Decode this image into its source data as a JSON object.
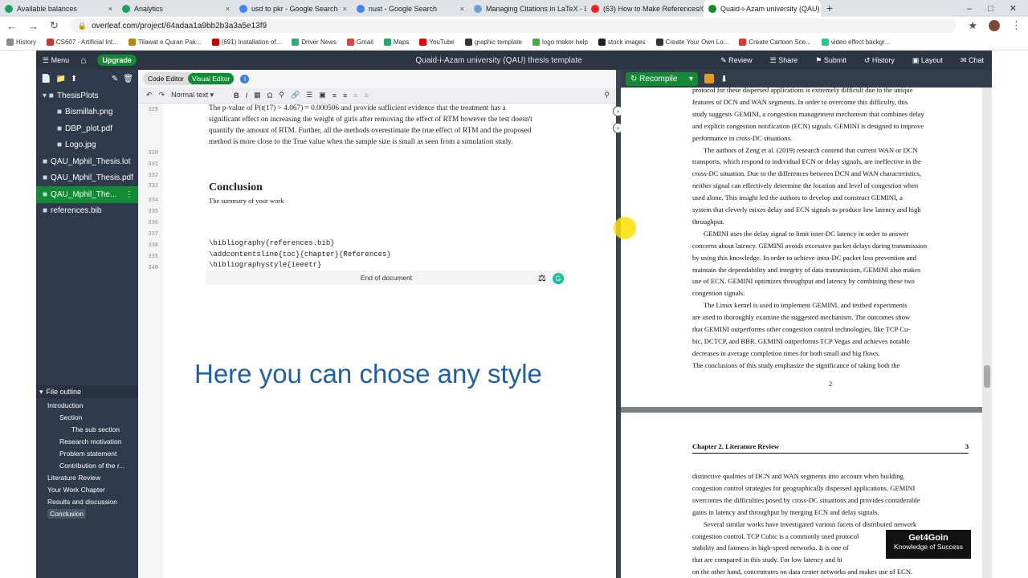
{
  "browser": {
    "tabs": [
      {
        "label": "Available balances",
        "color": "#1aa260"
      },
      {
        "label": "Analytics",
        "color": "#1aa260"
      },
      {
        "label": "usd to pkr - Google Search",
        "color": "#4285f4"
      },
      {
        "label": "nust - Google Search",
        "color": "#4285f4"
      },
      {
        "label": "Managing Citations in LaTeX - L",
        "color": "#6ca0d6"
      },
      {
        "label": "(63) How to Make References/C",
        "color": "#e22"
      },
      {
        "label": "Quaid-i-Azam university (QAU)",
        "color": "#138a36"
      }
    ],
    "url": "overleaf.com/project/64adaa1a9bb2b3a3a5e13f9",
    "bookmarks": [
      "History",
      "CS607 - Artificial Int...",
      "Tilawat e Quran Pak...",
      "(691) Installation of...",
      "Driver News",
      "Gmail",
      "Maps",
      "YouTube",
      "graphic template",
      "logo maker help",
      "stock images",
      "Create Your Own Lo...",
      "Create Cartoon Sce...",
      "video effect backgr..."
    ]
  },
  "topbar": {
    "menu": "Menu",
    "upgrade": "Upgrade",
    "title": "Quaid-i-Azam university (QAU) thesis template",
    "actions": [
      "Review",
      "Share",
      "Submit",
      "History",
      "Layout",
      "Chat"
    ]
  },
  "files": [
    {
      "name": "ThesisPlots",
      "indent": 0,
      "folder": true
    },
    {
      "name": "Bismillah.png",
      "indent": 1
    },
    {
      "name": "DBP_plot.pdf",
      "indent": 1
    },
    {
      "name": "Logo.jpg",
      "indent": 1
    },
    {
      "name": "QAU_Mphil_Thesis.lot",
      "indent": 0
    },
    {
      "name": "QAU_Mphil_Thesis.pdf",
      "indent": 0
    },
    {
      "name": "QAU_Mphil_The...",
      "indent": 0,
      "selected": true
    },
    {
      "name": "references.bib",
      "indent": 0
    }
  ],
  "outline": {
    "header": "File outline",
    "items": [
      {
        "label": "Introduction",
        "level": 0
      },
      {
        "label": "Section",
        "level": 1
      },
      {
        "label": "The sub section",
        "level": 2
      },
      {
        "label": "Research motivation",
        "level": 1
      },
      {
        "label": "Problem statement",
        "level": 1
      },
      {
        "label": "Contribution of the r...",
        "level": 1
      },
      {
        "label": "Literature Review",
        "level": 0
      },
      {
        "label": "Your Work Chapter",
        "level": 0
      },
      {
        "label": "Results and discussion",
        "level": 0
      },
      {
        "label": "Conclusion",
        "level": 0,
        "selected": true
      }
    ]
  },
  "editor": {
    "code_editor": "Code Editor",
    "visual_editor": "Visual Editor",
    "style": "Normal text",
    "line_numbers": [
      "329",
      "330",
      "331",
      "332",
      "333",
      "334",
      "335",
      "336",
      "337",
      "338",
      "339",
      "340"
    ],
    "para1": [
      "The p-value of P(t(17) > 4.067) = 0.000506 and provide sufficient evidence that the treatment has a",
      "significant effect on increasing the weight of girls after removing the effect of RTM however the test doesn't",
      "quantify the amount of RTM. Further, all the methods overestimate the true effect of RTM and the proposed",
      "method is more close to the True value when the sample size is small as seen from a simulation study."
    ],
    "heading": "Conclusion",
    "summary": "The summary of your work",
    "code_lines": [
      "\\bibliography{references.bib}",
      "\\addcontentsline{toc}{chapter}{References}",
      "\\bibliographystyle{ieeetr}"
    ],
    "end_of_document": "End of document",
    "overlay_caption": "Here you can chose any style"
  },
  "pdf": {
    "recompile": "Recompile",
    "page1_lines": [
      "protocol for these dispersed applications is extremely difficult due to the unique",
      "features of DCN and WAN segments. In order to overcome this difficulty, this",
      "study suggests GEMINI, a congestion management mechanism that combines delay",
      "and explicit congestion notification (ECN) signals. GEMINI is designed to improve",
      "performance in cross-DC situations.",
      "The authors of Zeng et al. (2019) research contend that current WAN or DCN",
      "transports, which respond to individual ECN or delay signals, are ineffective in the",
      "cross-DC situation. Due to the differences between DCN and WAN characteristics,",
      "neither signal can effectively determine the location and level of congestion when",
      "used alone. This insight led the authors to develop and construct GEMINI, a",
      "system that cleverly mixes delay and ECN signals to produce low latency and high",
      "throughput.",
      "GEMINI uses the delay signal to limit inter-DC latency in order to answer",
      "concerns about latency. GEMINI avoids excessive packet delays during transmission",
      "by using this knowledge. In order to achieve intra-DC packet loss prevention and",
      "maintain the dependability and integrity of data transmission, GEMINI also makes",
      "use of ECN. GEMINI optimizes throughput and latency by combining these two",
      "congestion signals.",
      "The Linux kernel is used to implement GEMINI, and testbed experiments",
      "are used to thoroughly examine the suggested mechanism. The outcomes show",
      "that GEMINI outperforms other congestion control technologies, like TCP Cu-",
      "bic, DCTCP, and BBR. GEMINI outperforms TCP Vegas and achieves notable",
      "decreases in average completion times for both small and big flows.",
      "The conclusions of this study emphasize the significance of taking both the"
    ],
    "page1_number": "2",
    "page2_header": "Chapter 2.   Literature Review",
    "page2_number": "3",
    "page2_lines": [
      "distinctive qualities of DCN and WAN segments into account when building",
      "congestion control strategies for geographically dispersed applications. GEMINI",
      "overcomes the difficulties posed by cross-DC situations and provides considerable",
      "gains in latency and throughput by merging ECN and delay signals.",
      "Several similar works have investigated various facets of distributed network",
      "congestion control. TCP Cubic is a commonly used protocol ",
      "stability and fairness in high-speed networks. It is one of",
      "that are compared in this study. For low latency and hi",
      "on the other hand, concentrates on data center networks and makes use of ECN."
    ]
  },
  "watermark": {
    "title": "Get4Goin",
    "subtitle": "Knowledge of Success"
  }
}
